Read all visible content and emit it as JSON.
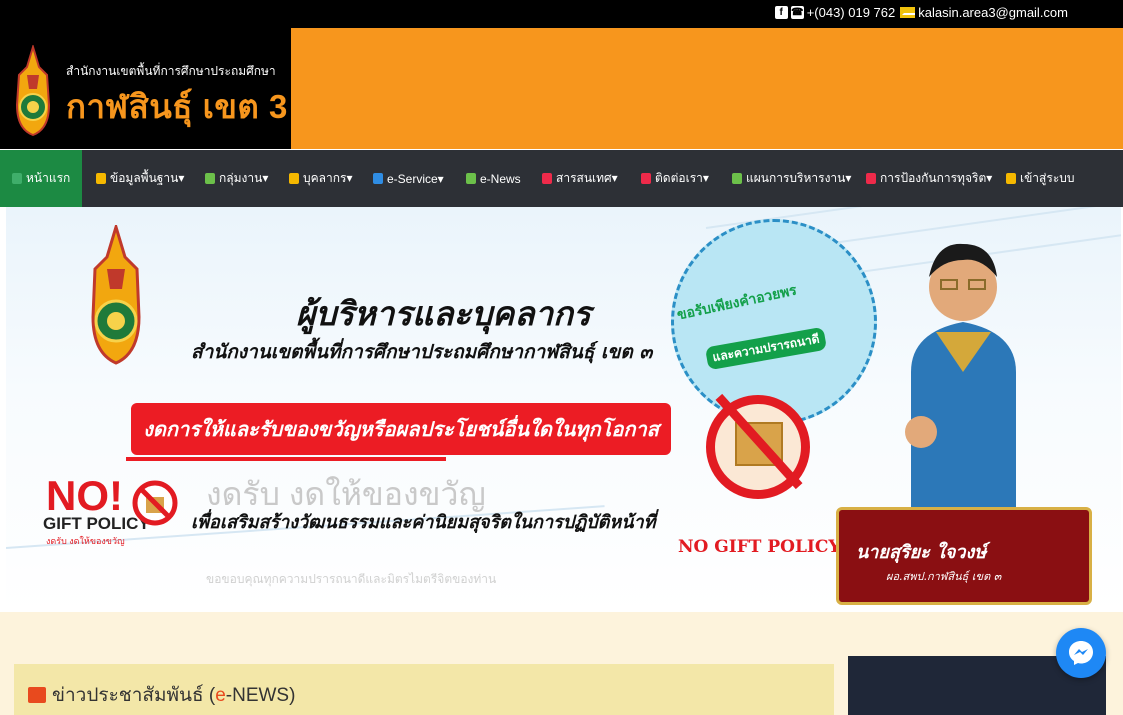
{
  "topbar": {
    "phone": "+(043) 019 762",
    "email": "kalasin.area3@gmail.com"
  },
  "header": {
    "subtitle": "สำนักงานเขตพื้นที่การศึกษาประถมศึกษา",
    "title": "กาฬสินธุ์ เขต 3"
  },
  "nav": {
    "items": [
      {
        "label": "หน้าแรก",
        "icon": "home-icon",
        "color": "#3fae6a"
      },
      {
        "label": "ข้อมูลพื้นฐาน▾",
        "icon": "info-icon",
        "color": "#f5b800"
      },
      {
        "label": "กลุ่มงาน▾",
        "icon": "folder-icon",
        "color": "#6cc04a"
      },
      {
        "label": "บุคลากร▾",
        "icon": "people-icon",
        "color": "#f5b800"
      },
      {
        "label": "e-Service▾",
        "icon": "monitor-icon",
        "color": "#2f8de4"
      },
      {
        "label": "e-News",
        "icon": "news-icon",
        "color": "#6cc04a"
      },
      {
        "label": "สารสนเทศ▾",
        "icon": "print-icon",
        "color": "#ee2a4a"
      },
      {
        "label": "ติดต่อเรา▾",
        "icon": "contact-icon",
        "color": "#ee2a4a"
      },
      {
        "label": "แผนการบริหารงาน▾",
        "icon": "plan-icon",
        "color": "#6cc04a"
      },
      {
        "label": "การป้องกันการทุจริต▾",
        "icon": "alarm-icon",
        "color": "#ee2a4a"
      },
      {
        "label": "เข้าสู่ระบบ",
        "icon": "key-icon",
        "color": "#f5b800"
      }
    ]
  },
  "banner": {
    "title": "ผู้บริหารและบุคลากร",
    "subtitle": "สำนักงานเขตพื้นที่การศึกษาประถมศึกษากาฬสินธุ์ เขต ๓",
    "red_bar": "งดการให้และรับของขวัญหรือผลประโยชน์อื่นใดในทุกโอกาส",
    "bottom_line": "เพื่อเสริมสร้างวัฒนธรรมและค่านิยมสุจริตในการปฏิบัติหน้าที่",
    "faded_large": "งดรับ งดให้ของขวัญ",
    "faded_small": "ขอขอบคุณทุกความปรารถนาดีและมิตรไมตรีจิตของท่าน",
    "no_text": "NO!",
    "gift_policy": "GIFT POLICY",
    "gift_small": "งดรับ งดให้ของขวัญ",
    "bubble_line1": "ขอรับเพียงคำอวยพร",
    "bubble_line2": "และความปรารถนาดี",
    "no_gift_policy": "NO GIFT POLICY",
    "person_name": "นายสุริยะ ใจวงษ์",
    "person_title": "ผอ.สพป.กาฬสินธุ์ เขต ๓"
  },
  "news": {
    "title_prefix": "ข่าวประชาสัมพันธ์ (",
    "title_accent": "e",
    "title_suffix": "-NEWS)",
    "accent_color": "#e84a1e"
  }
}
